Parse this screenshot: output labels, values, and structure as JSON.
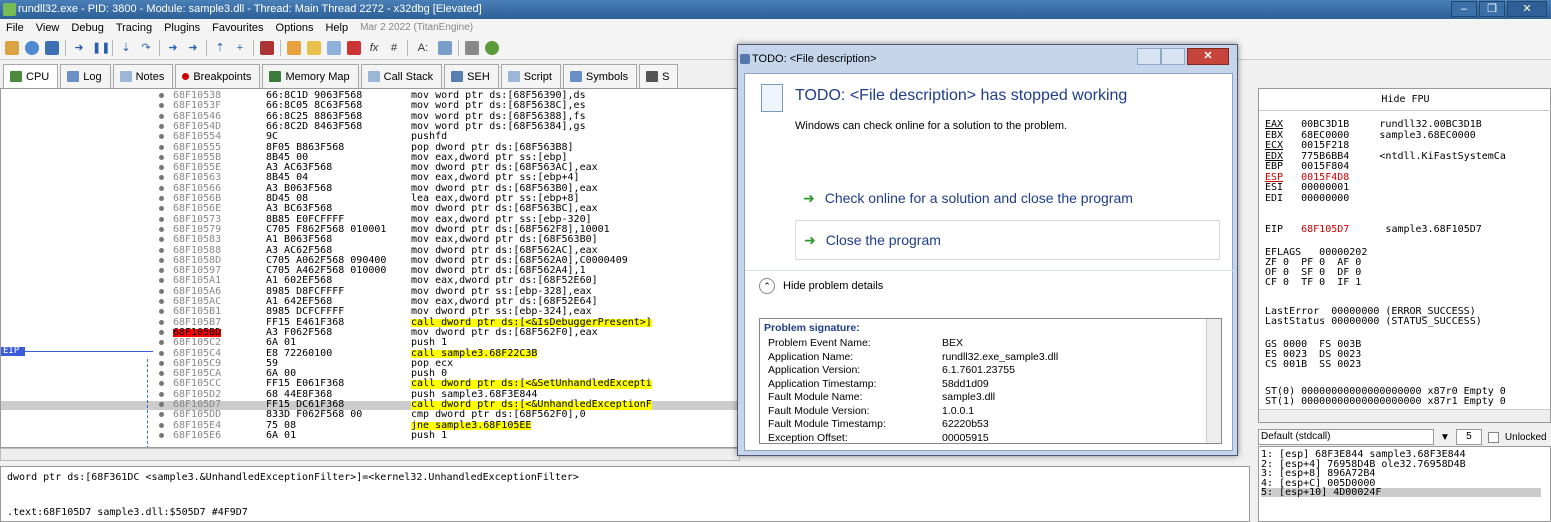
{
  "window": {
    "title": "rundll32.exe - PID: 3800 - Module: sample3.dll - Thread: Main Thread 2272 - x32dbg [Elevated]",
    "controls": [
      "–",
      "❐",
      "✕"
    ]
  },
  "menu": {
    "items": [
      "File",
      "View",
      "Debug",
      "Tracing",
      "Plugins",
      "Favourites",
      "Options",
      "Help"
    ],
    "date": "Mar 2 2022 (TitanEngine)"
  },
  "toolbar": {
    "icons": [
      "open-icon",
      "restart-icon",
      "stop-icon",
      "run-icon",
      "pause-icon",
      "step-into-icon",
      "step-over-icon",
      "trace-into-icon",
      "trace-over-icon",
      "run-to-user-icon",
      "skip-icon",
      "breakpoint-icon",
      "patch-icon",
      "script-icon",
      "comment-icon",
      "label-icon",
      "function-icon",
      "hash-icon",
      "font-icon",
      "calc-icon",
      "memory-icon",
      "help-icon"
    ],
    "glyph_fx": "fx",
    "glyph_hash": "#",
    "glyph_font": "A:"
  },
  "tabs": [
    {
      "label": "CPU",
      "icon": "cpu-icon",
      "active": true,
      "color": "#4b8a3f"
    },
    {
      "label": "Log",
      "icon": "log-icon",
      "color": "#6a8fc6"
    },
    {
      "label": "Notes",
      "icon": "notes-icon",
      "color": "#9bb6d6"
    },
    {
      "label": "Breakpoints",
      "icon": "breakpoint-dot-icon",
      "color": "#cc0000"
    },
    {
      "label": "Memory Map",
      "icon": "memory-map-icon",
      "color": "#3c7a3c"
    },
    {
      "label": "Call Stack",
      "icon": "call-stack-icon",
      "color": "#9bb6d6"
    },
    {
      "label": "SEH",
      "icon": "seh-icon",
      "color": "#5a7fae"
    },
    {
      "label": "Script",
      "icon": "script-icon",
      "color": "#9bb6d6"
    },
    {
      "label": "Symbols",
      "icon": "symbols-icon",
      "color": "#6a8fc6"
    },
    {
      "label": "S",
      "icon": "source-icon",
      "color": "#555555"
    }
  ],
  "disassembly": {
    "rows": [
      {
        "addr": "68F10538",
        "bytes": "66:8C1D 9063F568",
        "instr": "mov word ptr ds:[68F56390],ds"
      },
      {
        "addr": "68F1053F",
        "bytes": "66:8C05 8C63F568",
        "instr": "mov word ptr ds:[68F5638C],es"
      },
      {
        "addr": "68F10546",
        "bytes": "66:8C25 8863F568",
        "instr": "mov word ptr ds:[68F56388],fs"
      },
      {
        "addr": "68F1054D",
        "bytes": "66:8C2D 8463F568",
        "instr": "mov word ptr ds:[68F56384],gs"
      },
      {
        "addr": "68F10554",
        "bytes": "9C",
        "instr": "pushfd"
      },
      {
        "addr": "68F10555",
        "bytes": "8F05 B863F568",
        "instr": "pop dword ptr ds:[68F563B8]"
      },
      {
        "addr": "68F1055B",
        "bytes": "8B45 00",
        "instr": "mov eax,dword ptr ss:[ebp]"
      },
      {
        "addr": "68F1055E",
        "bytes": "A3 AC63F568",
        "instr": "mov dword ptr ds:[68F563AC],eax"
      },
      {
        "addr": "68F10563",
        "bytes": "8B45 04",
        "instr": "mov eax,dword ptr ss:[ebp+4]"
      },
      {
        "addr": "68F10566",
        "bytes": "A3 B063F568",
        "instr": "mov dword ptr ds:[68F563B0],eax"
      },
      {
        "addr": "68F1056B",
        "bytes": "8D45 08",
        "instr": "lea eax,dword ptr ss:[ebp+8]"
      },
      {
        "addr": "68F1056E",
        "bytes": "A3 BC63F568",
        "instr": "mov dword ptr ds:[68F563BC],eax"
      },
      {
        "addr": "68F10573",
        "bytes": "8B85 E0FCFFFF",
        "instr": "mov eax,dword ptr ss:[ebp-320]"
      },
      {
        "addr": "68F10579",
        "bytes": "C705 F862F568 010001",
        "instr": "mov dword ptr ds:[68F562F8],10001"
      },
      {
        "addr": "68F10583",
        "bytes": "A1 B063F568",
        "instr": "mov eax,dword ptr ds:[68F563B0]"
      },
      {
        "addr": "68F10588",
        "bytes": "A3 AC62F568",
        "instr": "mov dword ptr ds:[68F562AC],eax"
      },
      {
        "addr": "68F1058D",
        "bytes": "C705 A062F568 090400",
        "instr": "mov dword ptr ds:[68F562A0],C0000409"
      },
      {
        "addr": "68F10597",
        "bytes": "C705 A462F568 010000",
        "instr": "mov dword ptr ds:[68F562A4],1"
      },
      {
        "addr": "68F105A1",
        "bytes": "A1 602EF568",
        "instr": "mov eax,dword ptr ds:[68F52E60]"
      },
      {
        "addr": "68F105A6",
        "bytes": "8985 D8FCFFFF",
        "instr": "mov dword ptr ss:[ebp-328],eax"
      },
      {
        "addr": "68F105AC",
        "bytes": "A1 642EF568",
        "instr": "mov eax,dword ptr ds:[68F52E64]"
      },
      {
        "addr": "68F105B1",
        "bytes": "8985 DCFCFFFF",
        "instr": "mov dword ptr ss:[ebp-324],eax"
      },
      {
        "addr": "68F105B7",
        "bytes": "FF15 E461F368",
        "instr": "call dword ptr ds:[<&IsDebuggerPresent>]"
      },
      {
        "addr": "68F105BD",
        "bytes": "A3 F062F568",
        "instr": "mov dword ptr ds:[68F562F0],eax",
        "bp": true
      },
      {
        "addr": "68F105C2",
        "bytes": "6A 01",
        "instr": "push 1"
      },
      {
        "addr": "68F105C4",
        "bytes": "E8 72260100",
        "instr": "call sample3.68F22C3B"
      },
      {
        "addr": "68F105C9",
        "bytes": "59",
        "instr": "pop ecx"
      },
      {
        "addr": "68F105CA",
        "bytes": "6A 00",
        "instr": "push 0"
      },
      {
        "addr": "68F105CC",
        "bytes": "FF15 E061F368",
        "instr": "call dword ptr ds:[<&SetUnhandledExcepti"
      },
      {
        "addr": "68F105D2",
        "bytes": "68 44E8F368",
        "instr": "push sample3.68F3E844"
      },
      {
        "addr": "68F105D7",
        "bytes": "FF15 DC61F368",
        "instr": "call dword ptr ds:[<&UnhandledExceptionF",
        "eip": true
      },
      {
        "addr": "68F105DD",
        "bytes": "833D F062F568 00",
        "instr": "cmp dword ptr ds:[68F562F0],0"
      },
      {
        "addr": "68F105E4",
        "bytes": "75 08",
        "instr": "jne sample3.68F105EE"
      },
      {
        "addr": "68F105E6",
        "bytes": "6A 01",
        "instr": "push 1"
      }
    ],
    "eip_label": "EIP"
  },
  "info": {
    "line1": "dword ptr ds:[68F361DC <sample3.&UnhandledExceptionFilter>]=<kernel32.UnhandledExceptionFilter>",
    "line2": ".text:68F105D7 sample3.dll:$505D7 #4F9D7"
  },
  "registers": {
    "header": "Hide FPU",
    "rows": [
      {
        "name": "EAX",
        "value": "00BC3D1B",
        "note": "rundll32.00BC3D1B",
        "underline": true
      },
      {
        "name": "EBX",
        "value": "68EC0000",
        "note": "sample3.68EC0000"
      },
      {
        "name": "ECX",
        "value": "0015F218",
        "note": "",
        "underline": true
      },
      {
        "name": "EDX",
        "value": "775B6BB4",
        "note": "<ntdll.KiFastSystemCa",
        "underline": true
      },
      {
        "name": "EBP",
        "value": "0015F804",
        "note": ""
      },
      {
        "name": "ESP",
        "value": "0015F4D8",
        "note": "",
        "red": true,
        "underline": true
      },
      {
        "name": "ESI",
        "value": "00000001",
        "note": ""
      },
      {
        "name": "EDI",
        "value": "00000000",
        "note": ""
      }
    ],
    "eip": {
      "name": "EIP",
      "value": "68F105D7",
      "note": "sample3.68F105D7"
    },
    "eflags": "EFLAGS   00000202",
    "flags1": "ZF 0  PF 0  AF 0",
    "flags2": "OF 0  SF 0  DF 0",
    "flags3": "CF 0  TF 0  IF 1",
    "lasterror": "LastError  00000000 (ERROR_SUCCESS)",
    "laststatus": "LastStatus 00000000 (STATUS_SUCCESS)",
    "seg1": "GS 0000  FS 003B",
    "seg2": "ES 0023  DS 0023",
    "seg3": "CS 001B  SS 0023",
    "st0": "ST(0) 00000000000000000000 x87r0 Empty 0",
    "st1": "ST(1) 00000000000000000000 x87r1 Empty 0"
  },
  "stack": {
    "convention": "Default (stdcall)",
    "count": "5",
    "unlocked": "Unlocked",
    "rows": [
      "1: [esp] 68F3E844 sample3.68F3E844",
      "2: [esp+4] 76958D4B ole32.76958D4B",
      "3: [esp+8] 896A72B4",
      "4: [esp+C] 005D0000",
      "5: [esp+10] 4D00024F"
    ]
  },
  "dialog": {
    "title": "TODO: <File description>",
    "heading": "TODO: <File description> has stopped working",
    "subtitle": "Windows can check online for a solution to the problem.",
    "option1": "Check online for a solution and close the program",
    "option2": "Close the program",
    "hide_details": "Hide problem details",
    "problem_title": "Problem signature:",
    "problem_rows": [
      {
        "k": "Problem Event Name:",
        "v": "BEX"
      },
      {
        "k": "Application Name:",
        "v": "rundll32.exe_sample3.dll"
      },
      {
        "k": "Application Version:",
        "v": "6.1.7601.23755"
      },
      {
        "k": "Application Timestamp:",
        "v": "58dd1d09"
      },
      {
        "k": "Fault Module Name:",
        "v": "sample3.dll"
      },
      {
        "k": "Fault Module Version:",
        "v": "1.0.0.1"
      },
      {
        "k": "Fault Module Timestamp:",
        "v": "62220b53"
      },
      {
        "k": "Exception Offset:",
        "v": "00005915"
      }
    ]
  }
}
